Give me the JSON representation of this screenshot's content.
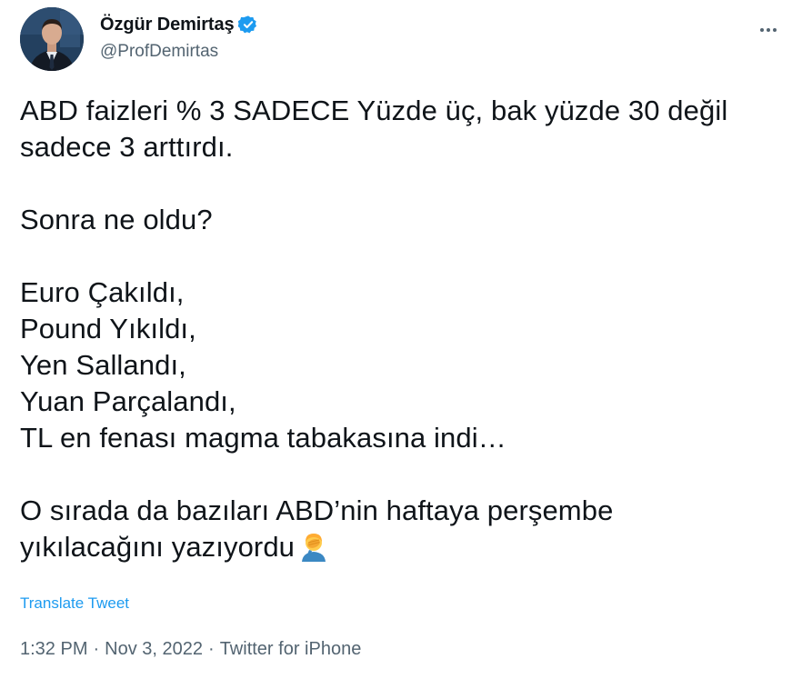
{
  "author": {
    "display_name": "Özgür Demirtaş",
    "handle": "@ProfDemirtas",
    "verified": true
  },
  "tweet": {
    "paragraph1_line1": "ABD faizleri % 3 SADECE Yüzde üç, bak yüzde 30 değil",
    "paragraph1_line2": "sadece 3 arttırdı.",
    "paragraph2": "Sonra ne oldu?",
    "list_lines": [
      "Euro Çakıldı,",
      "Pound Yıkıldı,",
      "Yen Sallandı,",
      "Yuan Parçalandı,",
      "TL en fenası magma tabakasına indi…"
    ],
    "paragraph4_line1": "O sırada da bazıları ABD’nin haftaya perşembe",
    "paragraph4_line2": "yıkılacağını yazıyordu",
    "emoji_name": "person-facepalming"
  },
  "translate_label": "Translate Tweet",
  "meta": {
    "time": "1:32 PM",
    "separator": "·",
    "date": "Nov 3, 2022",
    "source": "Twitter for iPhone"
  },
  "colors": {
    "text": "#0f1419",
    "secondary": "#536471",
    "accent": "#1d9bf0"
  }
}
